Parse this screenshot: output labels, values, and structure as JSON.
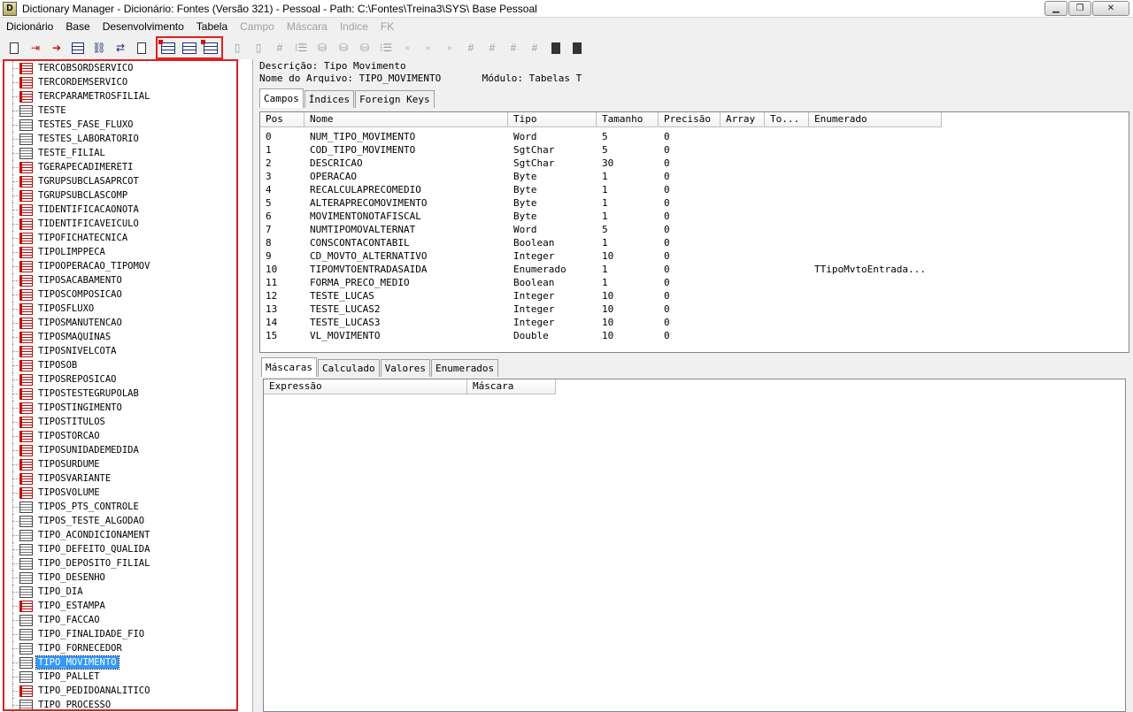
{
  "window": {
    "title": "Dictionary Manager - Dicionário: Fontes (Versão 321) - Pessoal  - Path: C:\\Fontes\\Treina3\\SYS\\ Base Pessoal",
    "minimize": "▁",
    "maximize": "❐",
    "close": "✕"
  },
  "menu": [
    {
      "label": "Dicionário",
      "enabled": true
    },
    {
      "label": "Base",
      "enabled": true
    },
    {
      "label": "Desenvolvimento",
      "enabled": true
    },
    {
      "label": "Tabela",
      "enabled": true
    },
    {
      "label": "Campo",
      "enabled": false
    },
    {
      "label": "Máscara",
      "enabled": false
    },
    {
      "label": "Indice",
      "enabled": false
    },
    {
      "label": "FK",
      "enabled": false
    }
  ],
  "toolbar": {
    "glyph_hash": "#",
    "glyph_list": "⁝☰",
    "glyph_db": "⛁",
    "glyph_node": "▫",
    "glyph_bar": "▯"
  },
  "tree": {
    "items": [
      {
        "label": "TERCOBSORDSERVICO",
        "red": true
      },
      {
        "label": "TERCORDEMSERVICO",
        "red": true
      },
      {
        "label": "TERCPARAMETROSFILIAL",
        "red": true
      },
      {
        "label": "TESTE",
        "red": false
      },
      {
        "label": "TESTES_FASE_FLUXO",
        "red": false
      },
      {
        "label": "TESTES_LABORATORIO",
        "red": false
      },
      {
        "label": "TESTE_FILIAL",
        "red": false
      },
      {
        "label": "TGERAPECADIMERETI",
        "red": true
      },
      {
        "label": "TGRUPSUBCLASAPRCOT",
        "red": true
      },
      {
        "label": "TGRUPSUBCLASCOMP",
        "red": true
      },
      {
        "label": "TIDENTIFICACAONOTA",
        "red": true
      },
      {
        "label": "TIDENTIFICAVEICULO",
        "red": true
      },
      {
        "label": "TIPOFICHATECNICA",
        "red": true
      },
      {
        "label": "TIPOLIMPPECA",
        "red": true
      },
      {
        "label": "TIPOOPERACAO_TIPOMOV",
        "red": true
      },
      {
        "label": "TIPOSACABAMENTO",
        "red": true
      },
      {
        "label": "TIPOSCOMPOSICAO",
        "red": true
      },
      {
        "label": "TIPOSFLUXO",
        "red": true
      },
      {
        "label": "TIPOSMANUTENCAO",
        "red": true
      },
      {
        "label": "TIPOSMAQUINAS",
        "red": true
      },
      {
        "label": "TIPOSNIVELCOTA",
        "red": true
      },
      {
        "label": "TIPOSOB",
        "red": true
      },
      {
        "label": "TIPOSREPOSICAO",
        "red": true
      },
      {
        "label": "TIPOSTESTEGRUPOLAB",
        "red": true
      },
      {
        "label": "TIPOSTINGIMENTO",
        "red": true
      },
      {
        "label": "TIPOSTITULOS",
        "red": true
      },
      {
        "label": "TIPOSTORCAO",
        "red": true
      },
      {
        "label": "TIPOSUNIDADEMEDIDA",
        "red": true
      },
      {
        "label": "TIPOSURDUME",
        "red": true
      },
      {
        "label": "TIPOSVARIANTE",
        "red": true
      },
      {
        "label": "TIPOSVOLUME",
        "red": true
      },
      {
        "label": "TIPOS_PTS_CONTROLE",
        "red": false
      },
      {
        "label": "TIPOS_TESTE_ALGODAO",
        "red": false
      },
      {
        "label": "TIPO_ACONDICIONAMENT",
        "red": false
      },
      {
        "label": "TIPO_DEFEITO_QUALIDA",
        "red": false
      },
      {
        "label": "TIPO_DEPOSITO_FILIAL",
        "red": false
      },
      {
        "label": "TIPO_DESENHO",
        "red": false
      },
      {
        "label": "TIPO_DIA",
        "red": false
      },
      {
        "label": "TIPO_ESTAMPA",
        "red": true
      },
      {
        "label": "TIPO_FACCAO",
        "red": false
      },
      {
        "label": "TIPO_FINALIDADE_FIO",
        "red": false
      },
      {
        "label": "TIPO_FORNECEDOR",
        "red": false
      },
      {
        "label": "TIPO_MOVIMENTO",
        "red": false,
        "selected": true
      },
      {
        "label": "TIPO_PALLET",
        "red": false
      },
      {
        "label": "TIPO_PEDIDOANALITICO",
        "red": true
      },
      {
        "label": "TIPO_PROCESSO",
        "red": false
      }
    ]
  },
  "details": {
    "descricao": "Descrição: Tipo Movimento",
    "arquivo": "Nome do Arquivo: TIPO_MOVIMENTO       Módulo: Tabelas T"
  },
  "top_tabs": [
    "Campos",
    "Índices",
    "Foreign Keys"
  ],
  "fields_grid": {
    "columns": [
      "Pos",
      "Nome",
      "Tipo",
      "Tamanho",
      "Precisão",
      "Array",
      "To...",
      "Enumerado"
    ],
    "rows": [
      [
        "0",
        "NUM_TIPO_MOVIMENTO",
        "Word",
        "5",
        "0",
        "",
        "",
        ""
      ],
      [
        "1",
        "COD_TIPO_MOVIMENTO",
        "SgtChar",
        "5",
        "0",
        "",
        "",
        ""
      ],
      [
        "2",
        "DESCRICAO",
        "SgtChar",
        "30",
        "0",
        "",
        "",
        ""
      ],
      [
        "3",
        "OPERACAO",
        "Byte",
        "1",
        "0",
        "",
        "",
        ""
      ],
      [
        "4",
        "RECALCULAPRECOMEDIO",
        "Byte",
        "1",
        "0",
        "",
        "",
        ""
      ],
      [
        "5",
        "ALTERAPRECOMOVIMENTO",
        "Byte",
        "1",
        "0",
        "",
        "",
        ""
      ],
      [
        "6",
        "MOVIMENTONOTAFISCAL",
        "Byte",
        "1",
        "0",
        "",
        "",
        ""
      ],
      [
        "7",
        "NUMTIPOMOVALTERNAT",
        "Word",
        "5",
        "0",
        "",
        "",
        ""
      ],
      [
        "8",
        "CONSCONTACONTABIL",
        "Boolean",
        "1",
        "0",
        "",
        "",
        ""
      ],
      [
        "9",
        "CD_MOVTO_ALTERNATIVO",
        "Integer",
        "10",
        "0",
        "",
        "",
        ""
      ],
      [
        "10",
        "TIPOMVTOENTRADASAIDA",
        "Enumerado",
        "1",
        "0",
        "",
        "",
        "TTipoMvtoEntrada..."
      ],
      [
        "11",
        "FORMA_PRECO_MEDIO",
        "Boolean",
        "1",
        "0",
        "",
        "",
        ""
      ],
      [
        "12",
        "TESTE_LUCAS",
        "Integer",
        "10",
        "0",
        "",
        "",
        ""
      ],
      [
        "13",
        "TESTE_LUCAS2",
        "Integer",
        "10",
        "0",
        "",
        "",
        ""
      ],
      [
        "14",
        "TESTE_LUCAS3",
        "Integer",
        "10",
        "0",
        "",
        "",
        ""
      ],
      [
        "15",
        "VL_MOVIMENTO",
        "Double",
        "10",
        "0",
        "",
        "",
        ""
      ]
    ]
  },
  "bottom_tabs": [
    "Máscaras",
    "Calculado",
    "Valores",
    "Enumerados"
  ],
  "mask_grid": {
    "columns": [
      "Expressão",
      "Máscara"
    ]
  }
}
